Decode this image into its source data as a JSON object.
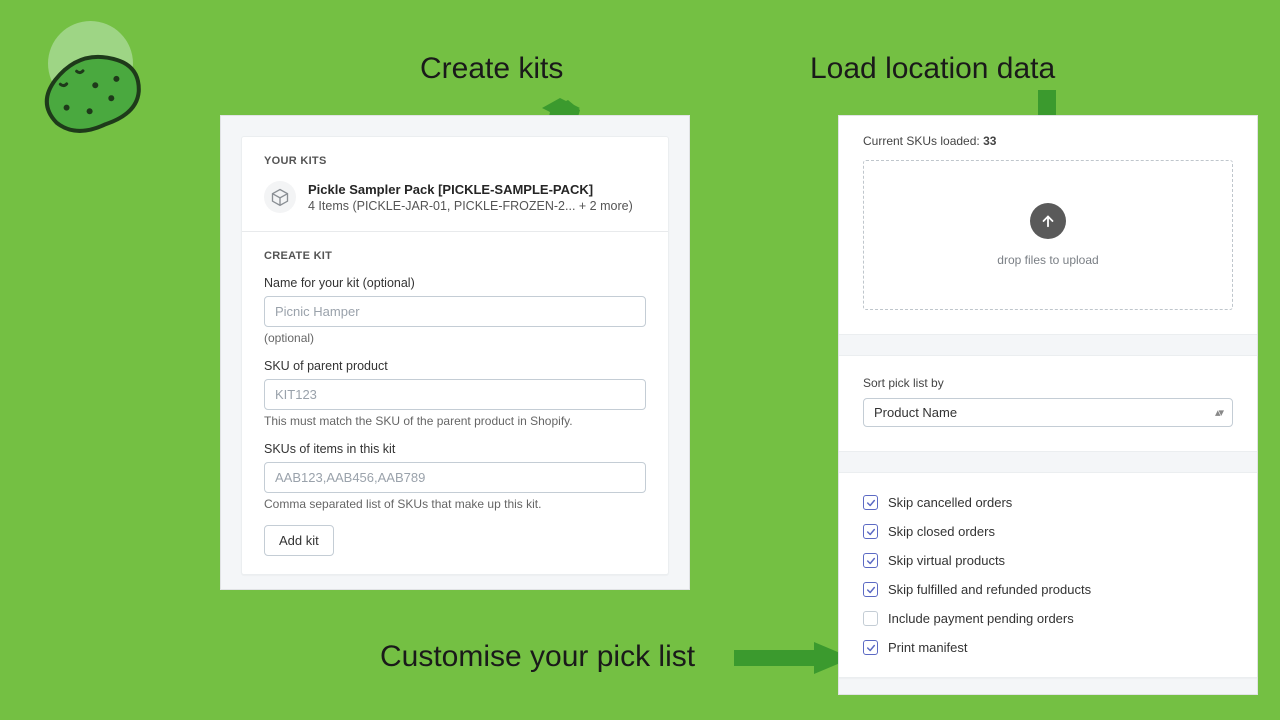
{
  "callouts": {
    "create_kits": "Create kits",
    "load_location": "Load location data",
    "customise": "Customise your pick list"
  },
  "left": {
    "kits_heading": "YOUR KITS",
    "kit_title": "Pickle Sampler Pack [PICKLE-SAMPLE-PACK]",
    "kit_sub": "4 Items (PICKLE-JAR-01, PICKLE-FROZEN-2... + 2 more)",
    "create_heading": "CREATE KIT",
    "name_label": "Name for your kit (optional)",
    "name_placeholder": "Picnic Hamper",
    "name_help": "(optional)",
    "sku_label": "SKU of parent product",
    "sku_placeholder": "KIT123",
    "sku_help": "This must match the SKU of the parent product in Shopify.",
    "items_label": "SKUs of items in this kit",
    "items_placeholder": "AAB123,AAB456,AAB789",
    "items_help": "Comma separated list of SKUs that make up this kit.",
    "add_btn": "Add kit"
  },
  "right": {
    "sku_loaded_label": "Current SKUs loaded: ",
    "sku_loaded_count": "33",
    "drop_text": "drop files to upload",
    "sort_label": "Sort pick list by",
    "sort_value": "Product Name",
    "checks": [
      {
        "label": "Skip cancelled orders",
        "checked": true
      },
      {
        "label": "Skip closed orders",
        "checked": true
      },
      {
        "label": "Skip virtual products",
        "checked": true
      },
      {
        "label": "Skip fulfilled and refunded products",
        "checked": true
      },
      {
        "label": "Include payment pending orders",
        "checked": false
      },
      {
        "label": "Print manifest",
        "checked": true
      }
    ]
  }
}
